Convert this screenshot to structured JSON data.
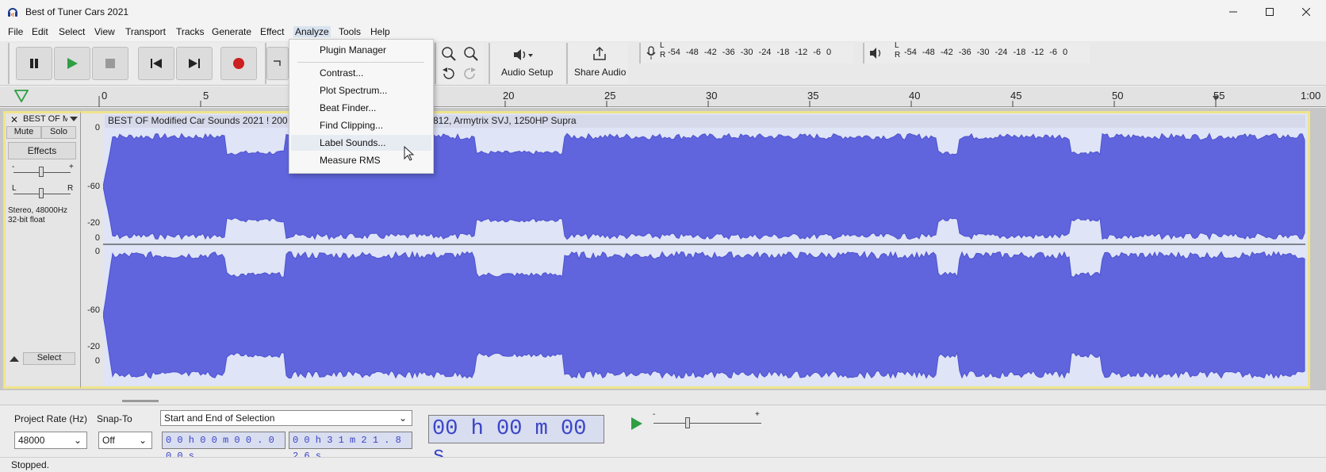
{
  "window": {
    "title": "Best of Tuner Cars 2021",
    "minimize_icon": "minimize-icon",
    "maximize_icon": "maximize-icon",
    "close_icon": "close-icon"
  },
  "menubar": {
    "items": [
      "File",
      "Edit",
      "Select",
      "View",
      "Transport",
      "Tracks",
      "Generate",
      "Effect",
      "Analyze",
      "Tools",
      "Help"
    ],
    "active": "Analyze"
  },
  "analyze_menu": {
    "items": [
      "Plugin Manager",
      "Contrast...",
      "Plot Spectrum...",
      "Beat Finder...",
      "Find Clipping...",
      "Label Sounds...",
      "Measure RMS"
    ],
    "hovered": "Label Sounds..."
  },
  "toolbar": {
    "audio_setup_label": "Audio Setup",
    "share_audio_label": "Share Audio",
    "record_meter_labels": [
      "-54",
      "-48",
      "-42",
      "-36",
      "-30",
      "-24",
      "-18",
      "-12",
      "-6",
      "0"
    ],
    "play_meter_labels": [
      "-54",
      "-48",
      "-42",
      "-36",
      "-30",
      "-24",
      "-18",
      "-12",
      "-6",
      "0"
    ],
    "meter_l": "L",
    "meter_r": "R"
  },
  "ruler": {
    "labels": [
      "0",
      "5",
      "20",
      "25",
      "30",
      "35",
      "40",
      "45",
      "50",
      "55",
      "1:00"
    ]
  },
  "track": {
    "name": "BEST OF Mo",
    "mute_label": "Mute",
    "solo_label": "Solo",
    "effects_label": "Effects",
    "gain_minus": "-",
    "gain_plus": "+",
    "pan_left": "L",
    "pan_right": "R",
    "info_line1": "Stereo, 48000Hz",
    "info_line2": "32-bit float",
    "select_label": "Select",
    "clip_title": "BEST OF Modified Car Sounds 2021 ! 200",
    "clip_title_tail": "812, Armytrix SVJ, 1250HP Supra",
    "y_labels_top": [
      "0",
      "-60",
      "-20",
      "0"
    ],
    "y_labels_bottom": [
      "0",
      "-60",
      "-20",
      "0"
    ],
    "wave_color": "#6065dd"
  },
  "selection_toolbar": {
    "project_rate_label": "Project Rate (Hz)",
    "project_rate_value": "48000",
    "snap_to_label": "Snap-To",
    "snap_to_value": "Off",
    "selection_mode": "Start and End of Selection",
    "start_time": "0 0 h 0 0 m 0 0 . 0 0 0 s",
    "end_time": "0 0 h 3 1 m 2 1 . 8 2 6 s",
    "big_time": "00 h 00 m 00 s",
    "playspeed_minus": "-",
    "playspeed_plus": "+"
  },
  "status": {
    "text": "Stopped."
  }
}
